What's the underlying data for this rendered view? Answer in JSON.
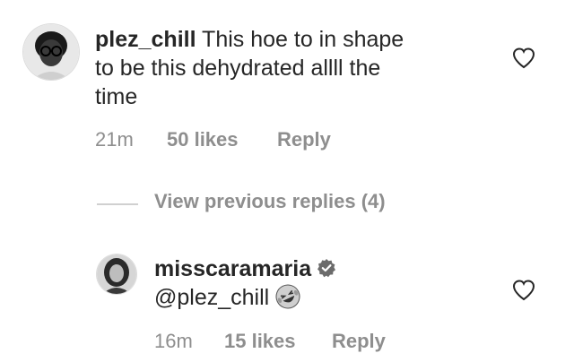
{
  "comments": [
    {
      "username": "plez_chill",
      "text_line1": "This hoe to in shape",
      "text_line2": "to be this dehydrated allll the",
      "text_line3": "time",
      "time": "21m",
      "likes": "50 likes",
      "reply": "Reply",
      "avatar_icon": "user-avatar-glasses",
      "like_icon": "heart-outline-icon"
    },
    {
      "username": "misscaramaria",
      "verified": true,
      "text": "@plez_chill",
      "emoji": "rolling-on-floor-laughing",
      "time": "16m",
      "likes": "15 likes",
      "reply": "Reply",
      "avatar_icon": "user-avatar",
      "like_icon": "heart-outline-icon"
    }
  ],
  "view_previous": {
    "label": "View previous replies (4)"
  }
}
